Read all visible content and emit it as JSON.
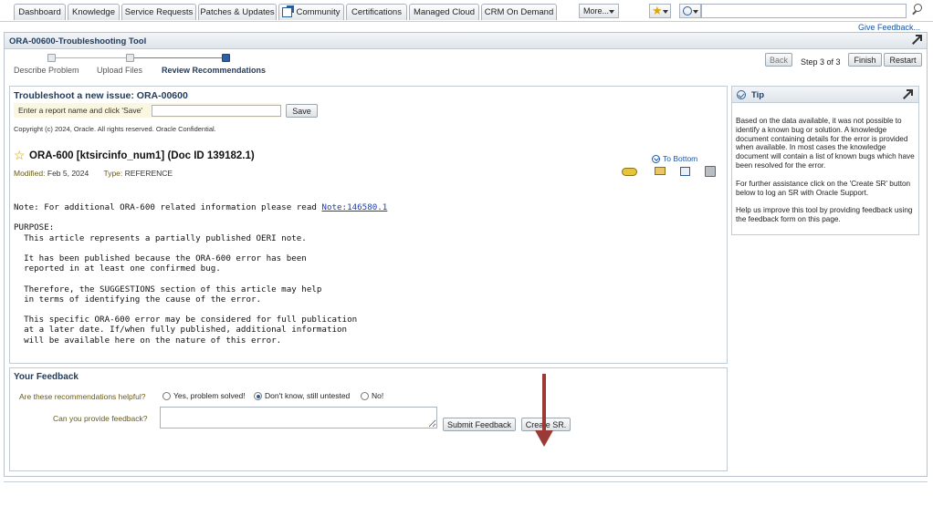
{
  "nav": {
    "tabs": [
      "Dashboard",
      "Knowledge",
      "Service Requests",
      "Patches & Updates",
      "Community",
      "Certifications",
      "Managed Cloud",
      "CRM On Demand"
    ],
    "more_label": "More...",
    "give_feedback": "Give Feedback..."
  },
  "tool": {
    "title": "ORA-00600-Troubleshooting Tool",
    "steps": [
      "Describe Problem",
      "Upload Files",
      "Review Recommendations"
    ],
    "active_step": 3,
    "back_label": "Back",
    "step_text": "Step 3 of 3",
    "finish_label": "Finish",
    "restart_label": "Restart"
  },
  "issue": {
    "heading": "Troubleshoot a new issue: ORA-00600",
    "report_label": "Enter a report name and click 'Save'",
    "report_value": "",
    "save_label": "Save",
    "copyright": "Copyright (c) 2024, Oracle. All rights reserved. Oracle Confidential."
  },
  "doc": {
    "title": "ORA-600 [ktsircinfo_num1] (Doc ID 139182.1)",
    "to_bottom": "To Bottom",
    "modified_label": "Modified:",
    "modified_value": "Feb 5, 2024",
    "type_label": "Type:",
    "type_value": "REFERENCE",
    "note_prefix": "Note: For additional ORA-600 related information please read ",
    "note_link": "Note:146580.1",
    "body": "PURPOSE:\n  This article represents a partially published OERI note.\n\n  It has been published because the ORA-600 error has been\n  reported in at least one confirmed bug.\n\n  Therefore, the SUGGESTIONS section of this article may help\n  in terms of identifying the cause of the error.\n\n  This specific ORA-600 error may be considered for full publication\n  at a later date. If/when fully published, additional information\n  will be available here on the nature of this error."
  },
  "feedback": {
    "heading": "Your Feedback",
    "question1": "Are these recommendations helpful?",
    "options": [
      "Yes, problem solved!",
      "Don't know, still untested",
      "No!"
    ],
    "selected_option": 1,
    "question2": "Can you provide feedback?",
    "feedback_value": "",
    "submit_label": "Submit Feedback",
    "create_sr_label": "Create SR."
  },
  "tip": {
    "title": "Tip",
    "paragraphs": [
      "Based on the data available, it was not possible to identify a known bug or solution. A knowledge document containing details for the error is provided when available. In most cases the knowledge document will contain a list of known bugs which have been resolved for the error.",
      "For further assistance click on the 'Create SR' button below to log an SR with Oracle Support.",
      "Help us improve this tool by providing feedback using the feedback form on this page."
    ]
  },
  "colors": {
    "accent": "#1f3a5c",
    "link": "#1a56a8",
    "arrow": "#9b3a34"
  }
}
